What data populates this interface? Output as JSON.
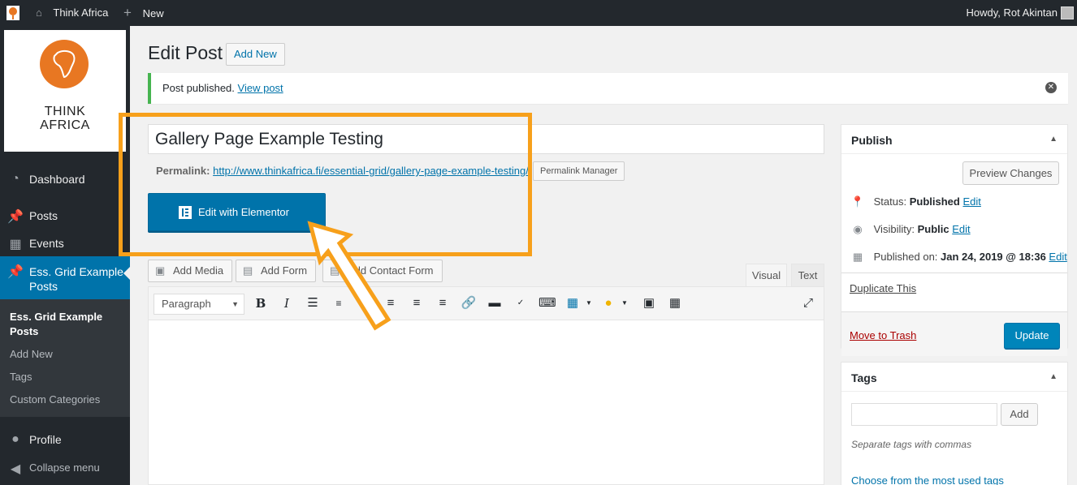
{
  "adminbar": {
    "site_name": "Think Africa",
    "new_label": "New",
    "howdy": "Howdy, Rot Akintan"
  },
  "sidebar": {
    "logo_text_line1": "THINK",
    "logo_text_line2": "AFRICA",
    "items": [
      {
        "label": "Dashboard",
        "icon": "dashboard-icon"
      },
      {
        "label": "Posts",
        "icon": "pin-icon"
      },
      {
        "label": "Events",
        "icon": "calendar-icon"
      },
      {
        "label": "Ess. Grid Example Posts",
        "icon": "pin-icon"
      },
      {
        "label": "Profile",
        "icon": "user-icon"
      },
      {
        "label": "Collapse menu",
        "icon": "collapse-icon"
      }
    ],
    "submenu": [
      {
        "label": "Ess. Grid Example Posts"
      },
      {
        "label": "Add New"
      },
      {
        "label": "Tags"
      },
      {
        "label": "Custom Categories"
      }
    ]
  },
  "header": {
    "title": "Edit Post",
    "add_new": "Add New"
  },
  "notice": {
    "text": "Post published.",
    "link": "View post"
  },
  "editor": {
    "post_title": "Gallery Page Example Testing",
    "permalink_label": "Permalink:",
    "permalink_url": "http://www.thinkafrica.fi/essential-grid/gallery-page-example-testing/",
    "permalink_manager": "Permalink Manager",
    "elementor_button": "Edit with Elementor",
    "media_buttons": [
      "Add Media",
      "Add Form",
      "Add Contact Form"
    ],
    "tabs": [
      "Visual",
      "Text"
    ],
    "format_select": "Paragraph"
  },
  "publish": {
    "title": "Publish",
    "preview": "Preview Changes",
    "status_label": "Status:",
    "status_value": "Published",
    "visibility_label": "Visibility:",
    "visibility_value": "Public",
    "published_label": "Published on:",
    "published_value": "Jan 24, 2019 @ 18:36",
    "edit": "Edit",
    "duplicate": "Duplicate This",
    "trash": "Move to Trash",
    "update": "Update"
  },
  "tags": {
    "title": "Tags",
    "add": "Add",
    "help": "Separate tags with commas",
    "choose": "Choose from the most used tags"
  },
  "colors": {
    "accent": "#0073aa",
    "annotation": "#f7a01b",
    "logo_orange": "#e87722",
    "notice_success": "#46b450"
  }
}
